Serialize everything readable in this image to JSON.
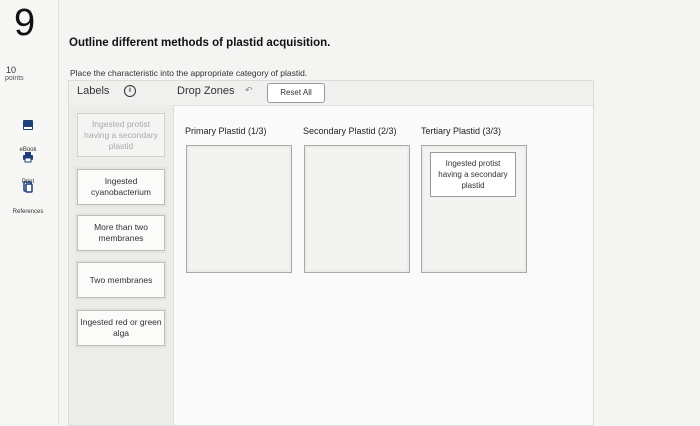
{
  "question": {
    "number": "9",
    "points_value": "10",
    "points_label": "points",
    "title": "Outline different methods of plastid acquisition."
  },
  "sidebar": {
    "tools": [
      {
        "label": "eBook",
        "icon": "book-icon"
      },
      {
        "label": "Print",
        "icon": "printer-icon"
      },
      {
        "label": "References",
        "icon": "references-icon"
      }
    ]
  },
  "activity": {
    "instruction": "Place the characteristic into the appropriate category of plastid.",
    "labels_title": "Labels",
    "dropzones_title": "Drop Zones",
    "reset_label": "Reset All",
    "labels": [
      {
        "text": "Ingested protist having a secondary plastid",
        "used": true
      },
      {
        "text": "Ingested cyanobacterium",
        "used": false
      },
      {
        "text": "More than two membranes",
        "used": false
      },
      {
        "text": "Two membranes",
        "used": false
      },
      {
        "text": "Ingested red or green alga",
        "used": false
      }
    ],
    "dropzones": [
      {
        "title": "Primary Plastid (1/3)",
        "placed": []
      },
      {
        "title": "Secondary Plastid (2/3)",
        "placed": []
      },
      {
        "title": "Tertiary Plastid (3/3)",
        "placed": [
          "Ingested protist having a secondary plastid"
        ]
      }
    ]
  }
}
